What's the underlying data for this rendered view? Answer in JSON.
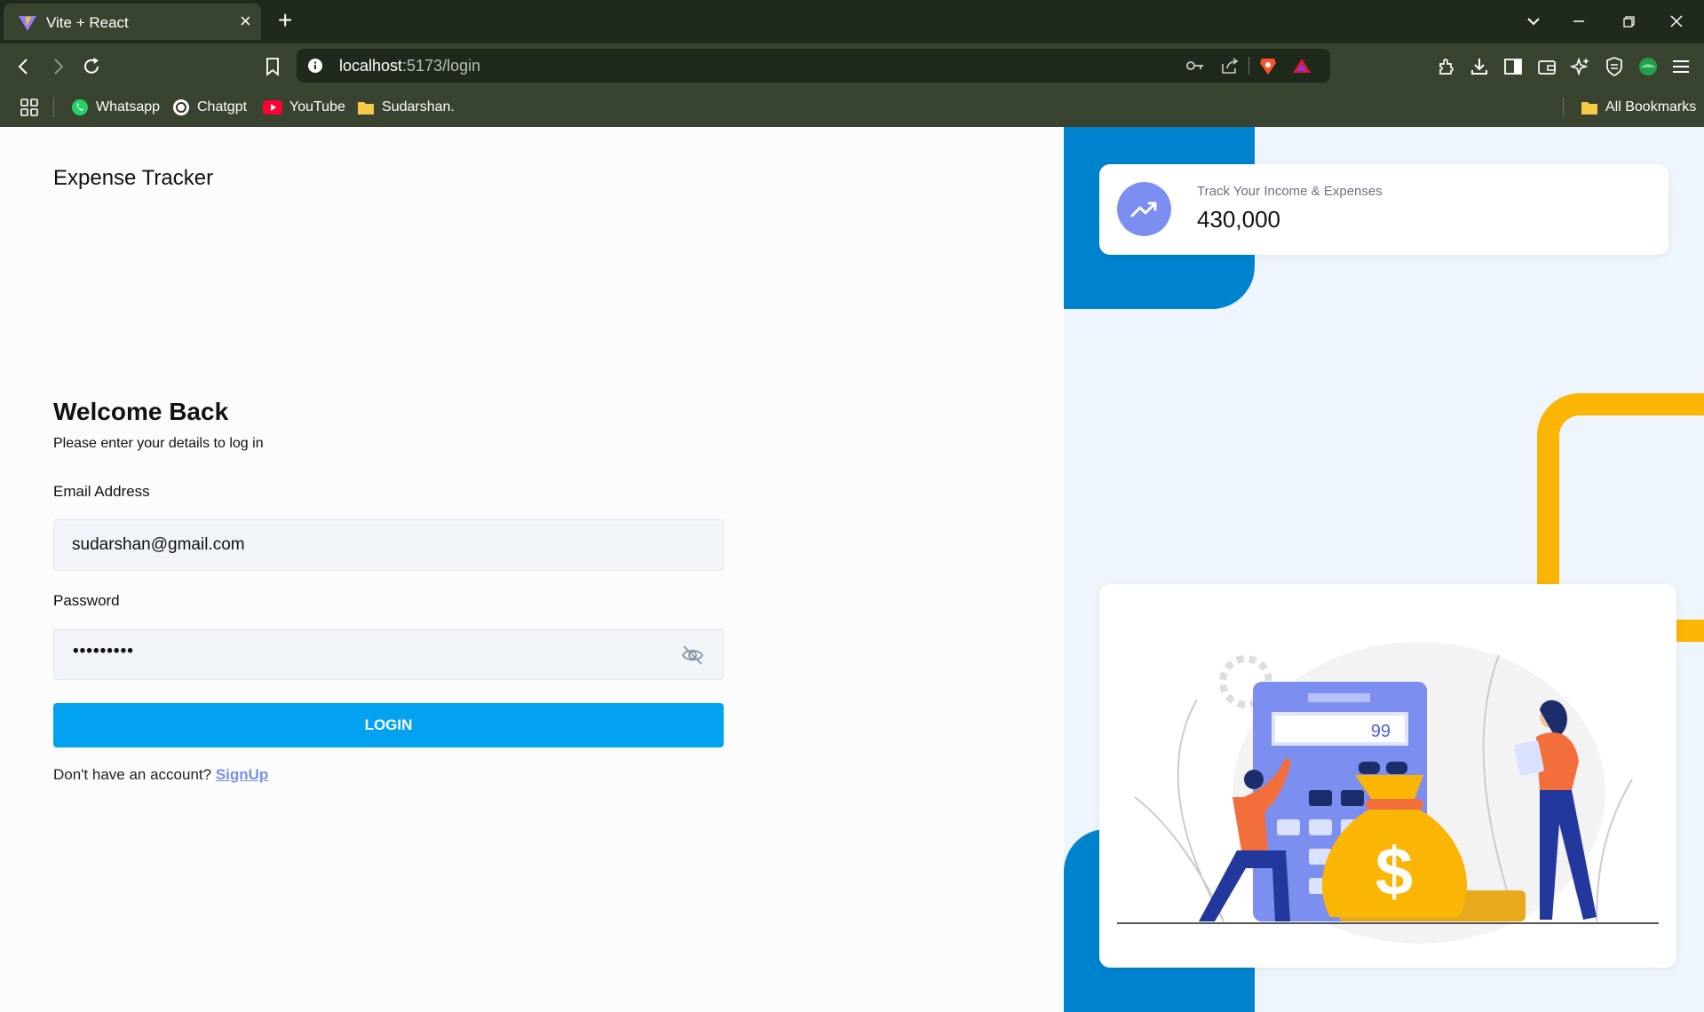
{
  "browser": {
    "tab_title": "Vite + React",
    "url_host": "localhost",
    "url_rest": ":5173/login",
    "bookmarks": [
      {
        "label": "Whatsapp",
        "icon": "whatsapp-icon"
      },
      {
        "label": "Chatgpt",
        "icon": "chatgpt-icon"
      },
      {
        "label": "YouTube",
        "icon": "youtube-icon"
      },
      {
        "label": "Sudarshan.",
        "icon": "folder-icon"
      }
    ],
    "all_bookmarks": "All Bookmarks"
  },
  "app": {
    "brand": "Expense Tracker",
    "welcome_title": "Welcome Back",
    "welcome_subtitle": "Please enter your details to log in",
    "email_label": "Email Address",
    "email_value": "sudarshan@gmail.com",
    "password_label": "Password",
    "password_masked": "•••••••••",
    "login_button": "LOGIN",
    "signup_prompt": "Don't have an account?",
    "signup_link": "SignUp"
  },
  "stats_card": {
    "label": "Track Your Income & Expenses",
    "value": "430,000",
    "icon": "trending-up-icon"
  },
  "illustration": {
    "calculator_display": "99",
    "icon": "money-bag-icon"
  },
  "colors": {
    "primary": "#03a2f1",
    "accent_blue": "#0083cf",
    "accent_yellow": "#fbb505",
    "icon_purple": "#7c8ff0"
  }
}
